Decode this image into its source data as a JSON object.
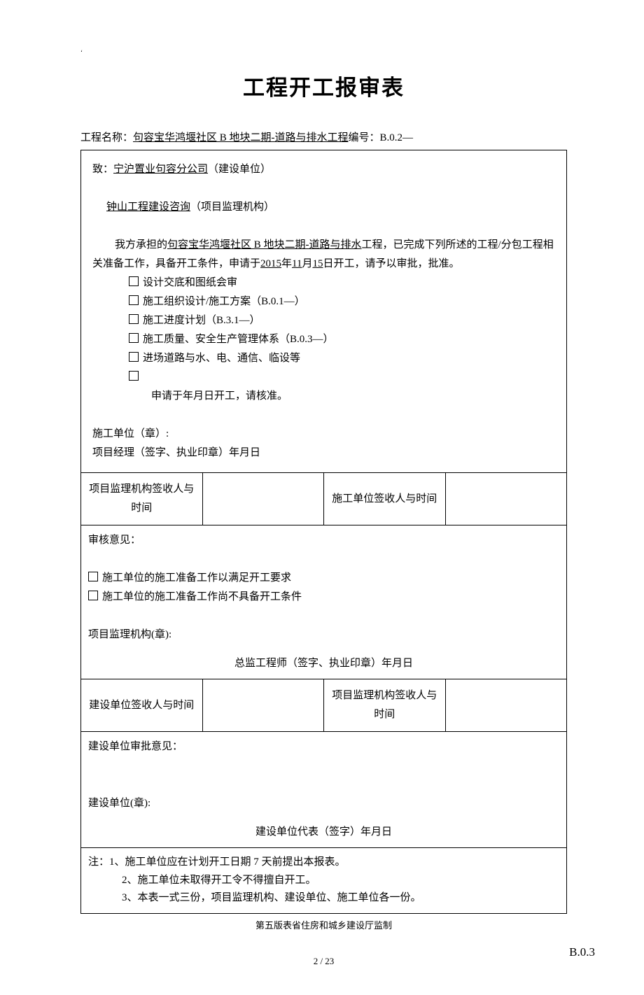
{
  "dot": "‘",
  "title": "工程开工报审表",
  "header": {
    "label_project": "工程名称：",
    "project_name": "句容宝华鸿堰社区 B 地块二期-道路与排水工程",
    "label_code": "编号：",
    "code": "B.0.2—"
  },
  "section1": {
    "to": "致：",
    "builder": "宁沪置业句容分公司",
    "builder_role": "（建设单位）",
    "supervisor": "钟山工程建设咨询",
    "supervisor_role": "（项目监理机构）",
    "p1_a": "我方承担的",
    "p1_b": "句容宝华鸿堰社区 B 地块二期-道路与排水",
    "p1_c": "工程，已完成下列所述的工程/分包工程相关准备工作，具备开工条件，申请于",
    "year": "2015",
    "y_l": "年",
    "month": "11",
    "m_l": "月",
    "day": "15",
    "d_l": "日开工，请予以审批，批准。",
    "checks": [
      "设计交底和图纸会审",
      "施工组织设计/施工方案（B.0.1—）",
      "施工进度计划（B.3.1—）",
      "施工质量、安全生产管理体系（B.0.3—）",
      "进场道路与水、电、通信、临设等",
      ""
    ],
    "apply": "申请于年月日开工，请核准。",
    "unit_seal": "施工单位（章）:",
    "pm_sig": "项目经理（签字、执业印章）年月日"
  },
  "sigrow1": {
    "c1": "项目监理机构签收人与时间",
    "c3": "施工单位签收人与时间"
  },
  "section2": {
    "h": "审核意见：",
    "opt1": "施工单位的施工准备工作以满足开工要求",
    "opt2": "施工单位的施工准备工作尚不具备开工条件",
    "org_seal": "项目监理机构(章):",
    "engineer": "总监工程师（签字、执业印章）年月日"
  },
  "sigrow2": {
    "c1": "建设单位签收人与时间",
    "c3": "项目监理机构签收人与时间"
  },
  "section3": {
    "h": "建设单位审批意见：",
    "seal": "建设单位(章):",
    "rep": "建设单位代表（签字）年月日"
  },
  "notes": {
    "n1": "注：1、施工单位应在计划开工日期 7 天前提出本报表。",
    "n2": "2、施工单位未取得开工令不得擅自开工。",
    "n3": "3、本表一式三份，项目监理机构、建设单位、施工单位各一份。"
  },
  "footer": "第五版表省住房和城乡建设厅监制",
  "ref": "B.0.3",
  "pagenum": "2  /  23"
}
